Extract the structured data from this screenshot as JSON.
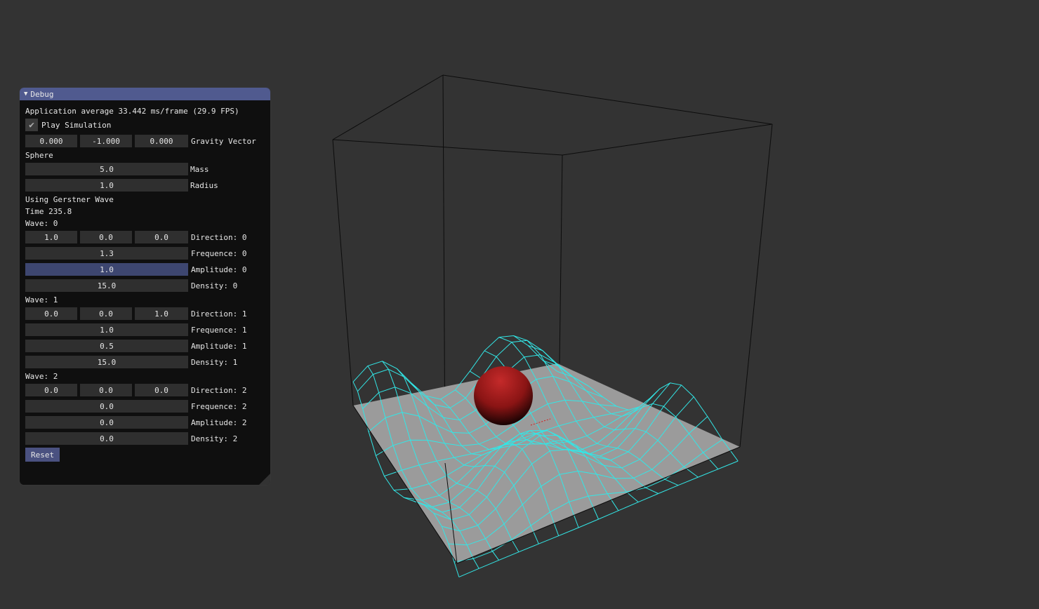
{
  "window": {
    "title": "Debug",
    "fps_text": "Application average 33.442 ms/frame (29.9 FPS)",
    "play_label": "Play Simulation",
    "play_checked": true,
    "gravity": [
      "0.000",
      "-1.000",
      "0.000"
    ],
    "gravity_label": "Gravity Vector",
    "sphere_header": "Sphere",
    "mass": {
      "value": "5.0",
      "label": "Mass"
    },
    "radius": {
      "value": "1.0",
      "label": "Radius"
    },
    "mode_text": "Using Gerstner Wave",
    "time_text": "Time 235.8",
    "waves": [
      {
        "header": "Wave: 0",
        "direction": [
          "1.0",
          "0.0",
          "0.0"
        ],
        "direction_label": "Direction: 0",
        "frequence": "1.3",
        "frequence_label": "Frequence: 0",
        "amplitude": "1.0",
        "amplitude_label": "Amplitude: 0",
        "density": "15.0",
        "density_label": "Density: 0"
      },
      {
        "header": "Wave: 1",
        "direction": [
          "0.0",
          "0.0",
          "1.0"
        ],
        "direction_label": "Direction: 1",
        "frequence": "1.0",
        "frequence_label": "Frequence: 1",
        "amplitude": "0.5",
        "amplitude_label": "Amplitude: 1",
        "density": "15.0",
        "density_label": "Density: 1"
      },
      {
        "header": "Wave: 2",
        "direction": [
          "0.0",
          "0.0",
          "0.0"
        ],
        "direction_label": "Direction: 2",
        "frequence": "0.0",
        "frequence_label": "Frequence: 2",
        "amplitude": "0.0",
        "amplitude_label": "Amplitude: 2",
        "density": "0.0",
        "density_label": "Density: 2"
      }
    ],
    "reset_label": "Reset"
  },
  "colors": {
    "background": "#333333",
    "panel": "#0f0f0f",
    "titlebar": "#505a8f",
    "field": "#2f2f2f",
    "field_active": "#3d4670",
    "button": "#4a5180",
    "wireframe": "#33e6e6",
    "plane": "#9b9b9b",
    "sphere": "#b01c1c"
  },
  "icons": {
    "collapse": "triangle-down-icon",
    "check": "check-icon"
  }
}
